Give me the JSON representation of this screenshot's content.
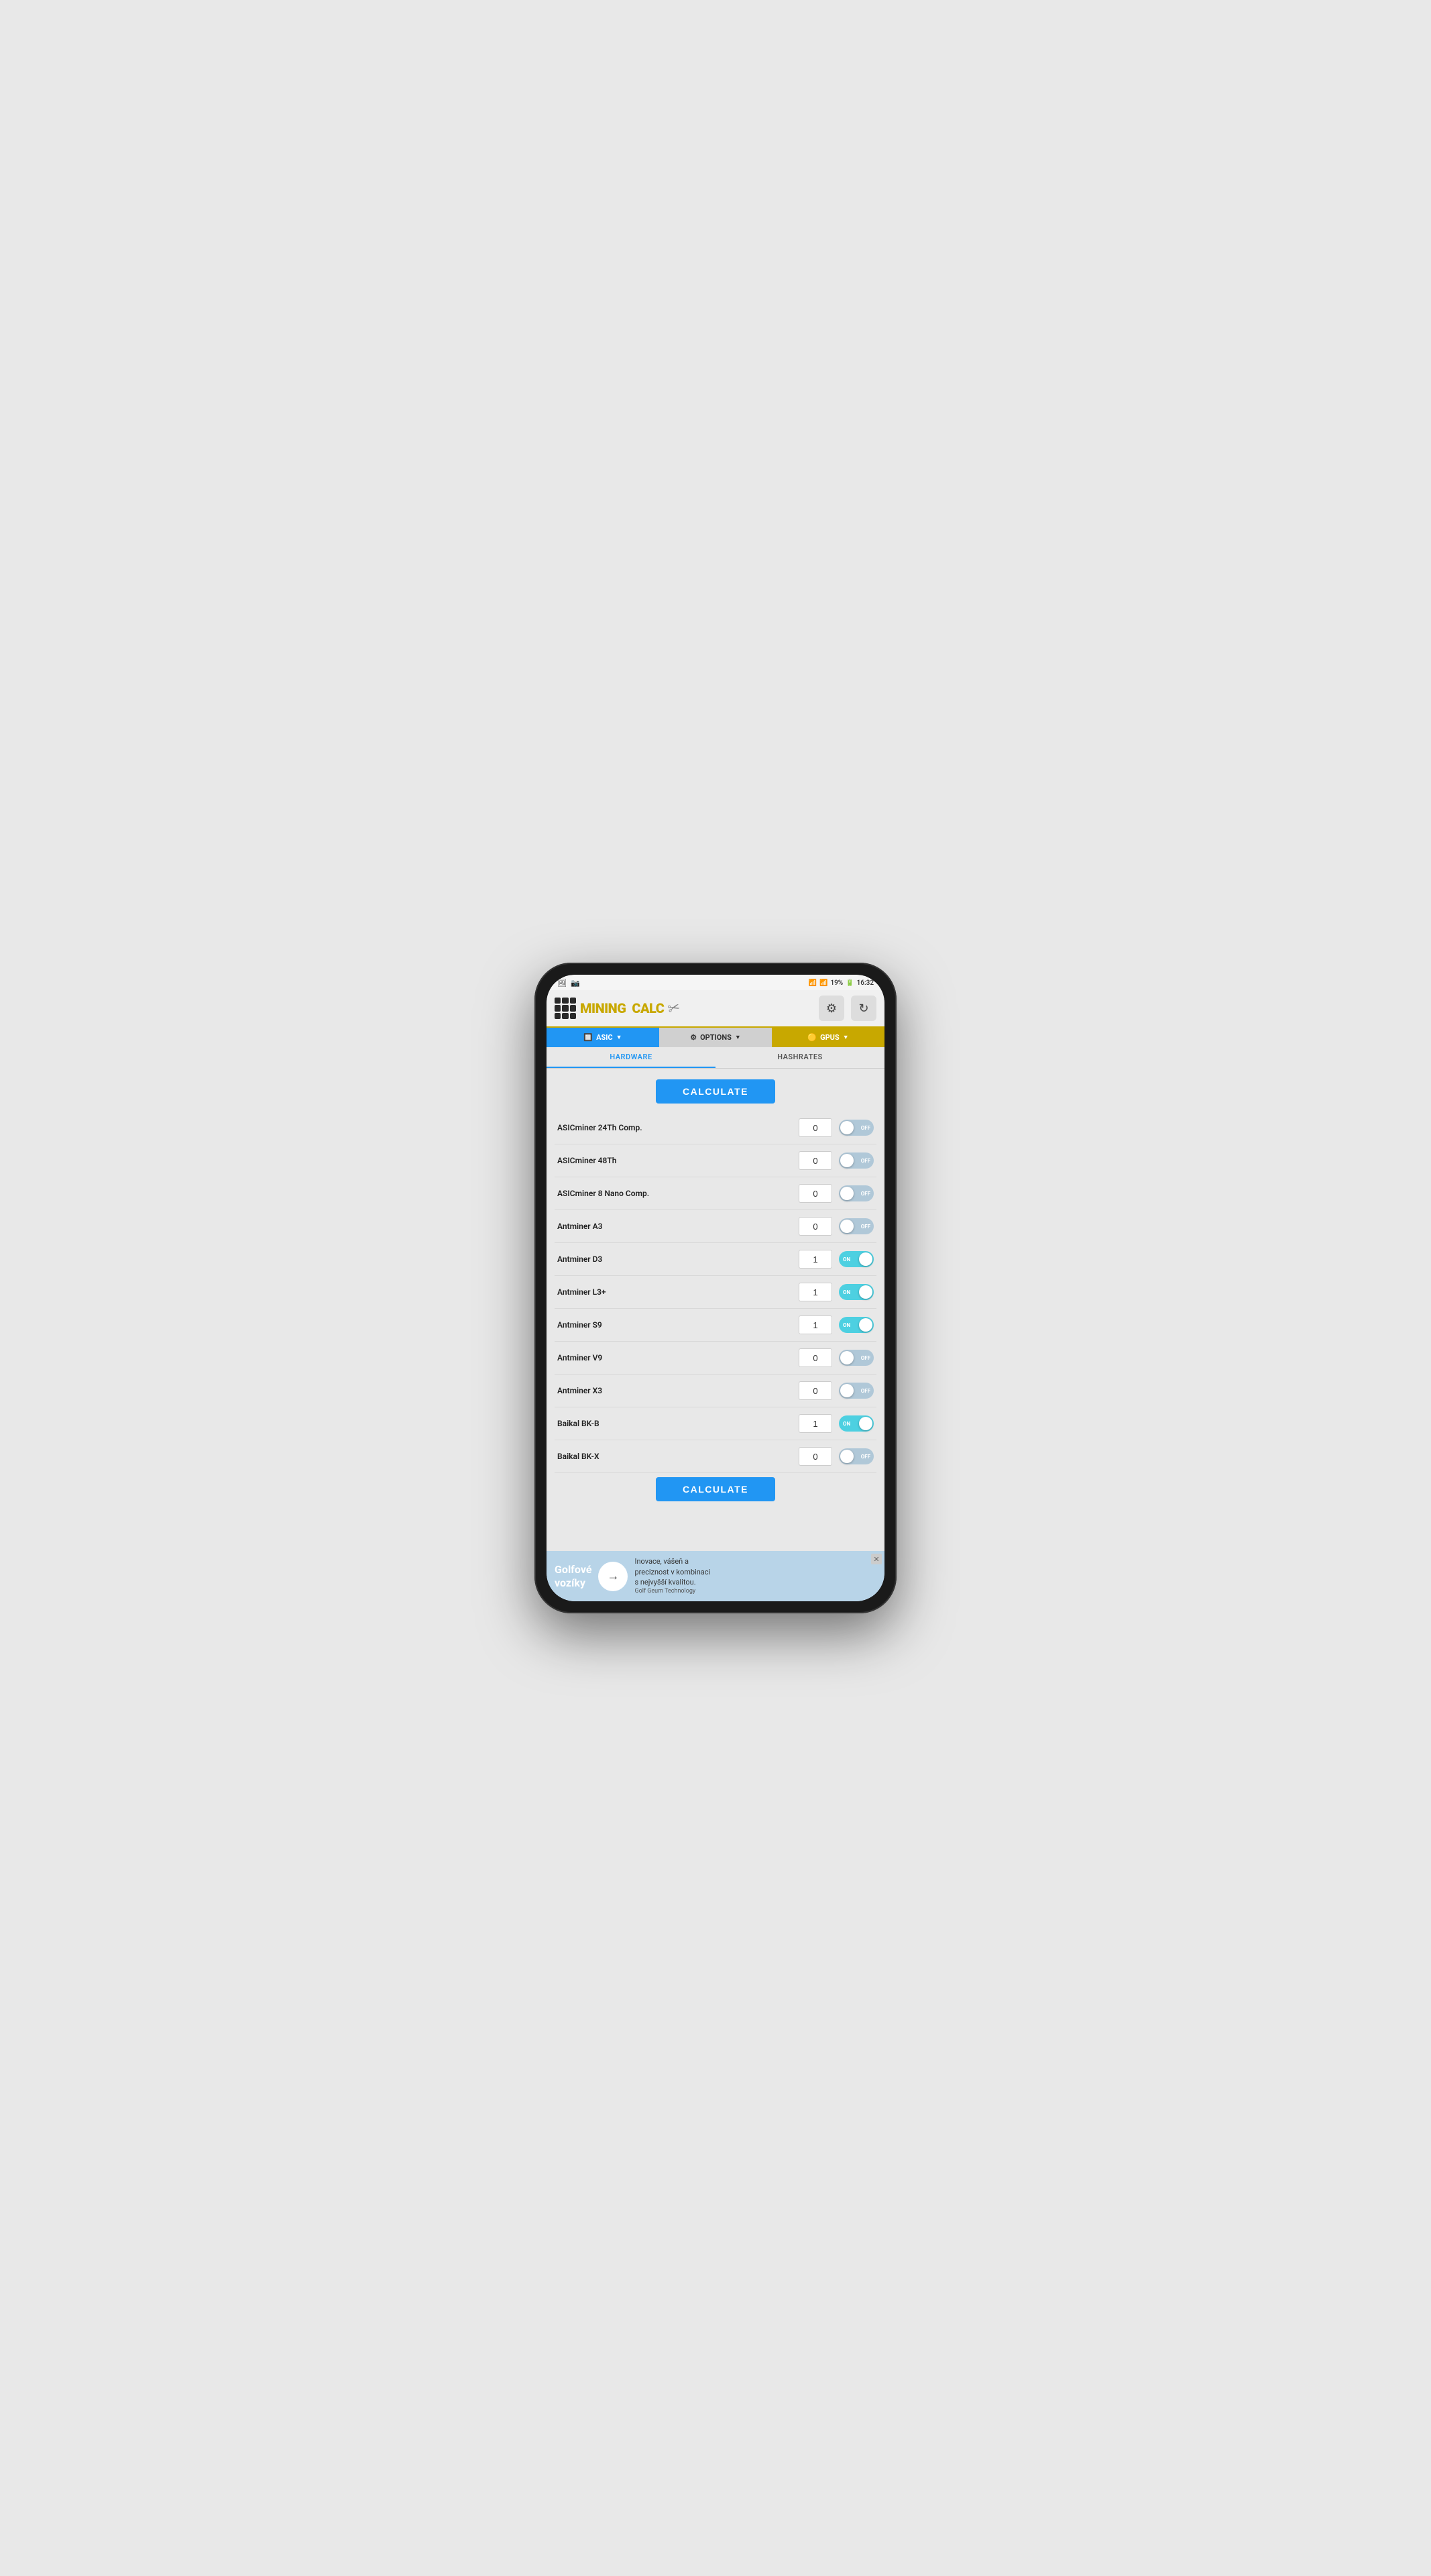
{
  "status_bar": {
    "battery": "19%",
    "time": "16:32",
    "signal": "WiFi",
    "network": "4G"
  },
  "header": {
    "logo_text_mining": "MINING",
    "logo_text_calc": "CALC",
    "settings_label": "⚙",
    "refresh_label": "↻"
  },
  "nav": {
    "asic_label": "ASIC",
    "options_label": "OPTIONS",
    "gpus_label": "GPUS"
  },
  "tabs": {
    "hardware_label": "HARDWARE",
    "hashrates_label": "HASHRATES"
  },
  "calculate_top": "CALCULATE",
  "calculate_bottom": "CALCULATE",
  "miners": [
    {
      "name": "ASICminer 24Th Comp.",
      "qty": "0",
      "state": "off"
    },
    {
      "name": "ASICminer 48Th",
      "qty": "0",
      "state": "off"
    },
    {
      "name": "ASICminer 8 Nano Comp.",
      "qty": "0",
      "state": "off"
    },
    {
      "name": "Antminer A3",
      "qty": "0",
      "state": "off"
    },
    {
      "name": "Antminer D3",
      "qty": "1",
      "state": "on"
    },
    {
      "name": "Antminer L3+",
      "qty": "1",
      "state": "on"
    },
    {
      "name": "Antminer S9",
      "qty": "1",
      "state": "on"
    },
    {
      "name": "Antminer V9",
      "qty": "0",
      "state": "off"
    },
    {
      "name": "Antminer X3",
      "qty": "0",
      "state": "off"
    },
    {
      "name": "Baikal BK-B",
      "qty": "1",
      "state": "on"
    },
    {
      "name": "Baikal BK-X",
      "qty": "0",
      "state": "off"
    }
  ],
  "ad": {
    "text_left": "Golfové\nvozíky",
    "arrow": "→",
    "text_right": "Inovace, vášeň a\npreciznost v kombinaci\ns nejvyšší kvalitou.",
    "company": "Golf Geum Technology"
  }
}
